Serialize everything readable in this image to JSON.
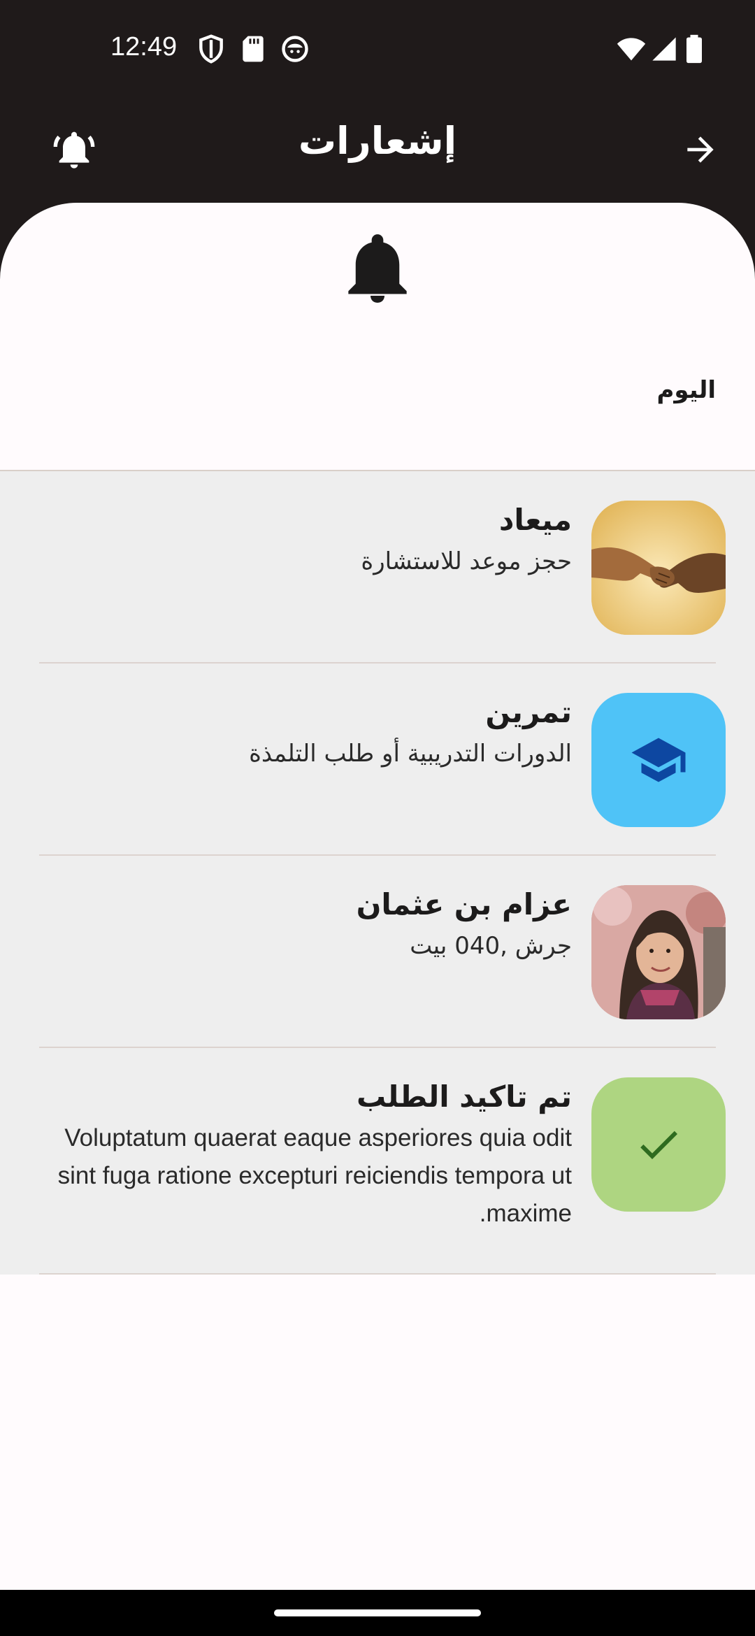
{
  "status_bar": {
    "time": "12:49",
    "left_icons": [
      "shield-icon",
      "sd-card-icon",
      "cat-face-icon"
    ],
    "right_icons": [
      "wifi-icon",
      "signal-icon",
      "battery-icon"
    ]
  },
  "header": {
    "title": "إشعارات",
    "left_icon": "bell-ringing-icon",
    "right_icon": "arrow-forward-icon"
  },
  "sheet": {
    "icon": "bell-icon",
    "section_label": "اليوم"
  },
  "notifications": [
    {
      "title": "ميعاد",
      "subtitle": "حجز موعد للاستشارة",
      "avatar": "handshake-photo",
      "avatar_color": "#e9c77a"
    },
    {
      "title": "تمرين",
      "subtitle": "الدورات التدريبية أو طلب التلمذة",
      "avatar": "graduation-cap-icon",
      "avatar_color": "#4fc3f7",
      "icon_color": "#0d47a1"
    },
    {
      "title": "عزام بن عثمان",
      "subtitle": "جرش ,040 بيت",
      "avatar": "person-photo",
      "avatar_color": "#c98b86"
    },
    {
      "title": "تم تاكيد الطلب",
      "subtitle": "Voluptatum quaerat eaque asperiores quia odit sint fuga ratione excepturi reiciendis tempora ut maxime.",
      "avatar": "check-icon",
      "avatar_color": "#aed581",
      "icon_color": "#2e6b1f"
    }
  ],
  "colors": {
    "header_bg": "#1f1a1a",
    "sheet_bg": "#fffbfd",
    "list_bg": "#eeeeee"
  }
}
